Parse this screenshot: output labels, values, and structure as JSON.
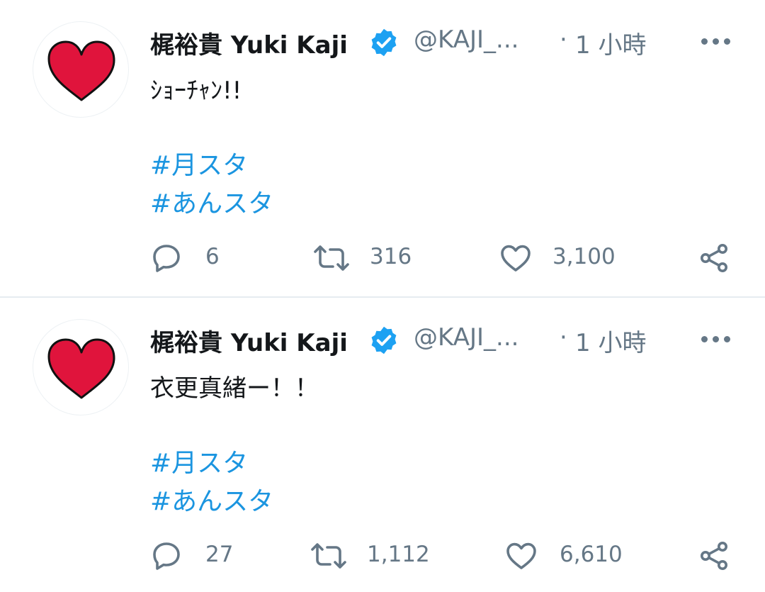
{
  "tweets": [
    {
      "display_name": "梶裕貴 Yuki Kaji",
      "handle": "@KAJI_...",
      "separator": "·",
      "time": "1 小時",
      "text": "ｼｮｰﾁｬﾝ!!",
      "hashtags": [
        "#月スタ",
        "#あんスタ"
      ],
      "replies": "6",
      "retweets": "316",
      "likes": "3,100"
    },
    {
      "display_name": "梶裕貴 Yuki Kaji",
      "handle": "@KAJI_...",
      "separator": "·",
      "time": "1 小時",
      "text": "衣更真緒ー！！",
      "hashtags": [
        "#月スタ",
        "#あんスタ"
      ],
      "replies": "27",
      "retweets": "1,112",
      "likes": "6,610"
    }
  ],
  "colors": {
    "link": "#1b95e0",
    "muted": "#657786",
    "verified": "#1da1f2",
    "avatar_heart": "#e0143c"
  },
  "icons": [
    "verified-badge-icon",
    "more-icon",
    "reply-icon",
    "retweet-icon",
    "like-icon",
    "share-icon"
  ]
}
